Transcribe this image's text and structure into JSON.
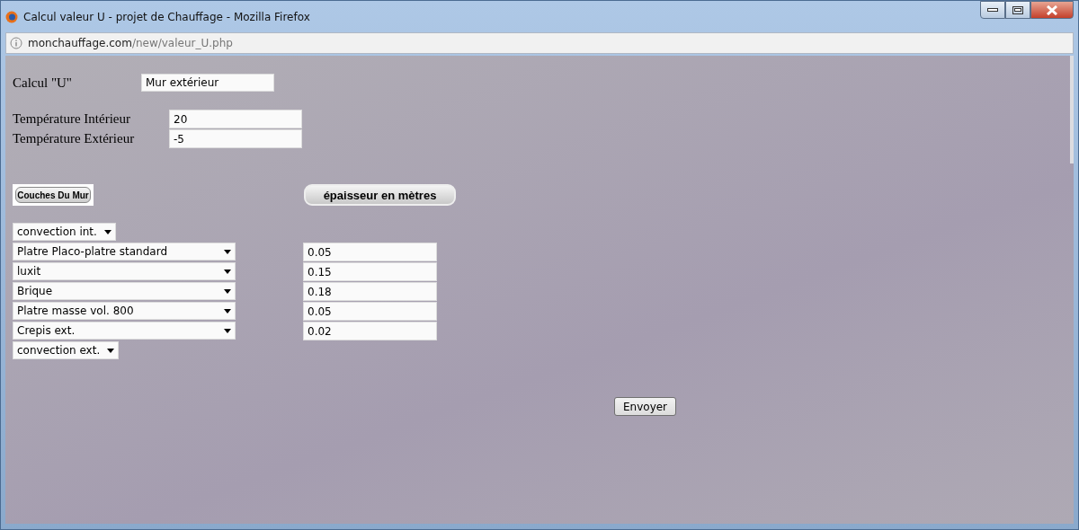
{
  "window": {
    "title": "Calcul valeur U - projet de Chauffage - Mozilla Firefox"
  },
  "address_bar": {
    "domain": "monchauffage.com",
    "path": "/new/valeur_U.php"
  },
  "form": {
    "title_label": "Calcul \"U\"",
    "wall_name": "Mur extérieur",
    "temperatures": [
      {
        "label": "Température Intérieur",
        "value": "20"
      },
      {
        "label": "Température Extérieur",
        "value": "-5"
      }
    ],
    "layers_button": "Couches Du Mur",
    "thickness_button": "épaisseur en mètres",
    "layers": [
      {
        "kind": "convection",
        "value": "convection int."
      },
      {
        "kind": "material",
        "value": "Platre Placo-platre standard",
        "thickness": "0.05"
      },
      {
        "kind": "material",
        "value": "luxit",
        "thickness": "0.15"
      },
      {
        "kind": "material",
        "value": "Brique",
        "thickness": "0.18"
      },
      {
        "kind": "material",
        "value": "Platre masse vol. 800",
        "thickness": "0.05"
      },
      {
        "kind": "material",
        "value": "Crepis ext.",
        "thickness": "0.02"
      },
      {
        "kind": "convection",
        "value": "convection ext."
      }
    ],
    "submit": "Envoyer"
  }
}
